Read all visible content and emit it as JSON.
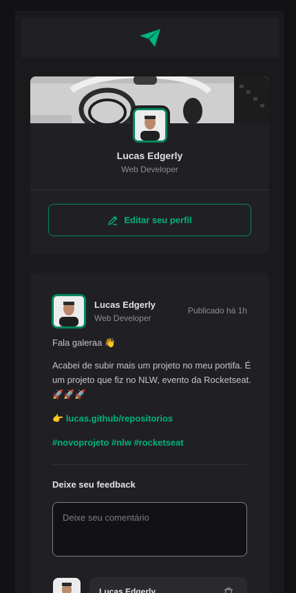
{
  "header": {
    "logo_icon": "paper-plane-icon"
  },
  "profile": {
    "name": "Lucas Edgerly",
    "role": "Web Developer",
    "edit_label": "Editar seu perfil"
  },
  "post": {
    "author": "Lucas Edgerly",
    "role": "Web Developer",
    "published": "Publicado há 1h",
    "greeting": "Fala galeraa 👋",
    "body": "Acabei de subir mais um projeto no meu portifa. É um projeto que fiz no NLW, evento da Rocketseat. 🚀🚀🚀",
    "link_prefix": "👉",
    "link": "lucas.github/repositorios",
    "hashtags": "#novoprojeto #nlw #rocketseat",
    "feedback_title": "Deixe seu feedback",
    "feedback_placeholder": "Deixe seu comentário"
  },
  "comment": {
    "author": "Lucas Edgerly"
  },
  "colors": {
    "accent": "#00b37e",
    "border_accent": "#00875f",
    "card": "#202024",
    "background": "#121214"
  }
}
